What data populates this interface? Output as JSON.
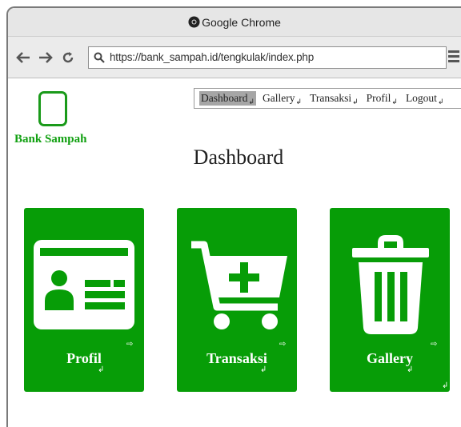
{
  "browser": {
    "title": "Google Chrome",
    "url": "https://bank_sampah.id/tengkulak/index.php"
  },
  "site": {
    "brand": "Bank Sampah"
  },
  "nav": {
    "items": [
      {
        "label": "Dashboard",
        "active": true
      },
      {
        "label": "Gallery",
        "active": false
      },
      {
        "label": "Transaksi",
        "active": false
      },
      {
        "label": "Profil",
        "active": false
      },
      {
        "label": "Logout",
        "active": false
      }
    ]
  },
  "main": {
    "title": "Dashboard",
    "cards": [
      {
        "label": "Profil",
        "icon": "id-card-icon"
      },
      {
        "label": "Transaksi",
        "icon": "cart-plus-icon"
      },
      {
        "label": "Gallery",
        "icon": "trash-bin-icon"
      }
    ]
  },
  "colors": {
    "accent_green": "#079d07",
    "brand_green": "#11a011",
    "active_nav": "#a6a6a6"
  }
}
